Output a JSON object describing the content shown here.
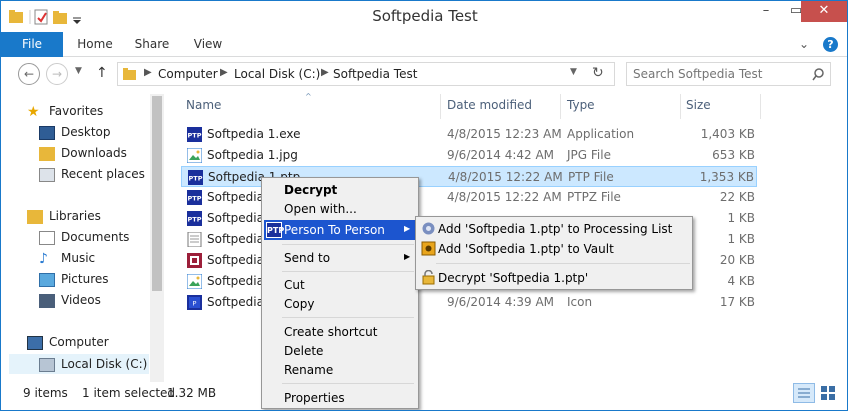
{
  "window": {
    "title": "Softpedia Test",
    "controls": {
      "minimize": "–",
      "maximize": "▭",
      "close": "✕"
    }
  },
  "ribbon": {
    "file": "File",
    "tabs": [
      "Home",
      "Share",
      "View"
    ],
    "expand": "⌄",
    "help": "?"
  },
  "address": {
    "back": "←",
    "forward": "→",
    "up": "↑",
    "crumbs": [
      "Computer",
      "Local Disk (C:)",
      "Softpedia Test"
    ],
    "refresh": "↻",
    "search_placeholder": "Search Softpedia Test"
  },
  "nav": {
    "favorites": "Favorites",
    "desktop": "Desktop",
    "downloads": "Downloads",
    "recent": "Recent places",
    "libraries": "Libraries",
    "documents": "Documents",
    "music": "Music",
    "pictures": "Pictures",
    "videos": "Videos",
    "computer": "Computer",
    "localdisk": "Local Disk (C:)"
  },
  "columns": {
    "name": "Name",
    "date": "Date modified",
    "type": "Type",
    "size": "Size"
  },
  "files": [
    {
      "name": "Softpedia 1.exe",
      "date": "4/8/2015 12:23 AM",
      "type": "Application",
      "size": "1,403 KB",
      "icon": "ptp-icon"
    },
    {
      "name": "Softpedia 1.jpg",
      "date": "9/6/2014 4:42 AM",
      "type": "JPG File",
      "size": "653 KB",
      "icon": "image-icon"
    },
    {
      "name": "Softpedia 1.ptp",
      "date": "4/8/2015 12:22 AM",
      "type": "PTP File",
      "size": "1,353 KB",
      "icon": "ptp-icon"
    },
    {
      "name": "Softpedia",
      "date": "4/8/2015 12:22 AM",
      "type": "PTPZ File",
      "size": "22 KB",
      "icon": "ptp-icon"
    },
    {
      "name": "Softpedia",
      "date": "",
      "type": "",
      "size": "1 KB",
      "icon": "ptp-icon"
    },
    {
      "name": "Softpedia",
      "date": "",
      "type": "",
      "size": "1 KB",
      "icon": "doc-icon"
    },
    {
      "name": "Softpedia",
      "date": "",
      "type": "",
      "size": "20 KB",
      "icon": "red-icon"
    },
    {
      "name": "Softpedia",
      "date": "",
      "type": "",
      "size": "4 KB",
      "icon": "image-icon"
    },
    {
      "name": "Softpedia",
      "date": "9/6/2014 4:39 AM",
      "type": "Icon",
      "size": "17 KB",
      "icon": "icon-file-icon"
    }
  ],
  "status": {
    "items": "9 items",
    "selected": "1 item selected",
    "size": "1.32 MB"
  },
  "context_menu": {
    "decrypt": "Decrypt",
    "open_with": "Open with...",
    "person_to_person": "Person To Person",
    "send_to": "Send to",
    "cut": "Cut",
    "copy": "Copy",
    "create_shortcut": "Create shortcut",
    "delete": "Delete",
    "rename": "Rename",
    "properties": "Properties",
    "arrow": "▶"
  },
  "submenu": {
    "add_processing": "Add 'Softpedia 1.ptp' to Processing List",
    "add_vault": "Add 'Softpedia 1.ptp' to Vault",
    "decrypt_file": "Decrypt 'Softpedia 1.ptp'"
  },
  "colors": {
    "accent": "#1979ca",
    "highlight": "#1c55cf",
    "selection": "#cce8ff"
  }
}
